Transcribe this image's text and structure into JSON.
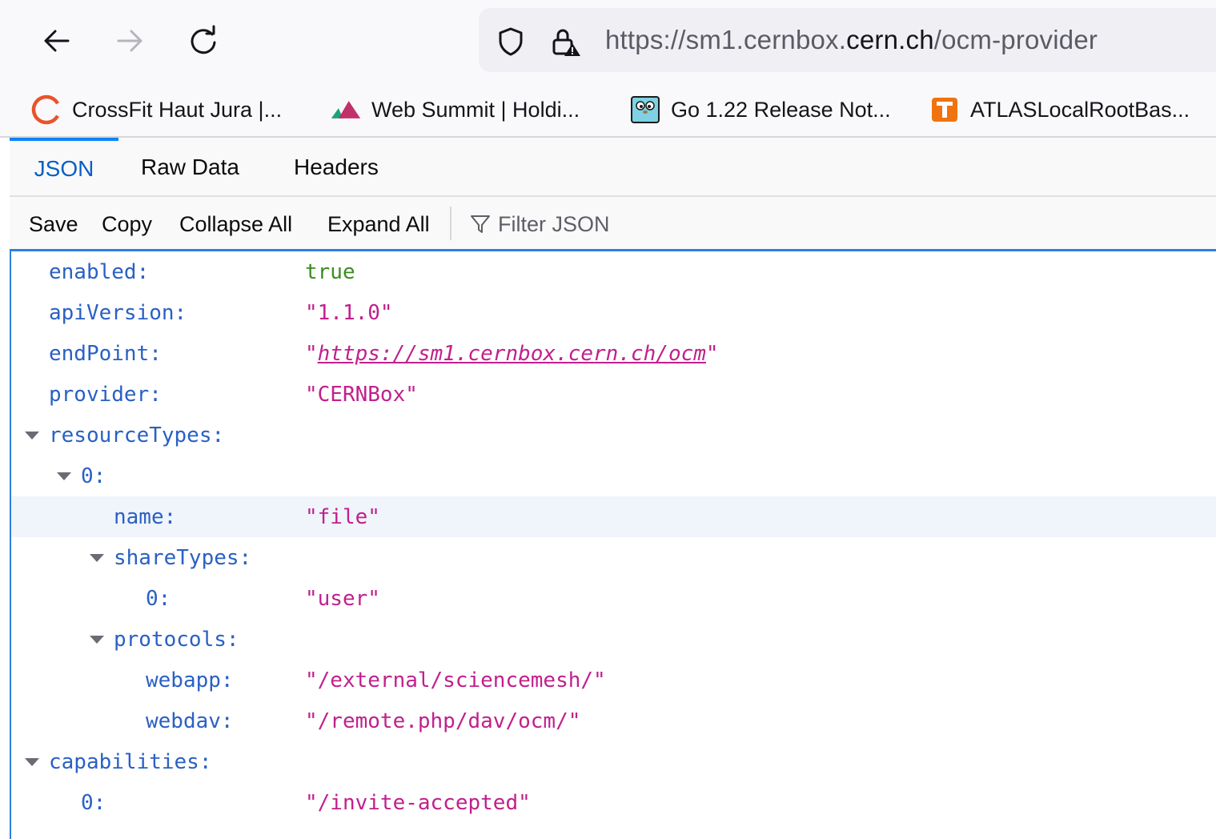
{
  "browser": {
    "url": {
      "prefix": "https://sm1.cernbox.",
      "host": "cern.ch",
      "path": "/ocm-provider"
    },
    "bookmarks": [
      {
        "label": "CrossFit Haut Jura |...",
        "icon": "crossfit-logo-icon"
      },
      {
        "label": "Web Summit | Holdi...",
        "icon": "web-summit-logo-icon"
      },
      {
        "label": "Go 1.22 Release Not...",
        "icon": "go-gopher-icon"
      },
      {
        "label": "ATLASLocalRootBas...",
        "icon": "atlas-logo-icon"
      }
    ]
  },
  "viewer": {
    "tabs": [
      "JSON",
      "Raw Data",
      "Headers"
    ],
    "toolbar": {
      "save": "Save",
      "copy": "Copy",
      "collapse_all": "Collapse All",
      "expand_all": "Expand All",
      "filter_placeholder": "Filter JSON"
    },
    "rows": [
      {
        "key": "enabled:",
        "value": "true"
      },
      {
        "key": "apiVersion:",
        "value": "\"1.1.0\""
      },
      {
        "key": "endPoint:",
        "value_open": "\"",
        "link": "https://sm1.cernbox.cern.ch/ocm",
        "value_close": "\""
      },
      {
        "key": "provider:",
        "value": "\"CERNBox\""
      },
      {
        "key": "resourceTypes:"
      },
      {
        "key": "0:"
      },
      {
        "key": "name:",
        "value": "\"file\""
      },
      {
        "key": "shareTypes:"
      },
      {
        "key": "0:",
        "value": "\"user\""
      },
      {
        "key": "protocols:"
      },
      {
        "key": "webapp:",
        "value": "\"/external/sciencemesh/\""
      },
      {
        "key": "webdav:",
        "value": "\"/remote.php/dav/ocm/\""
      },
      {
        "key": "capabilities:"
      },
      {
        "key": "0:",
        "value": "\"/invite-accepted\""
      }
    ]
  }
}
